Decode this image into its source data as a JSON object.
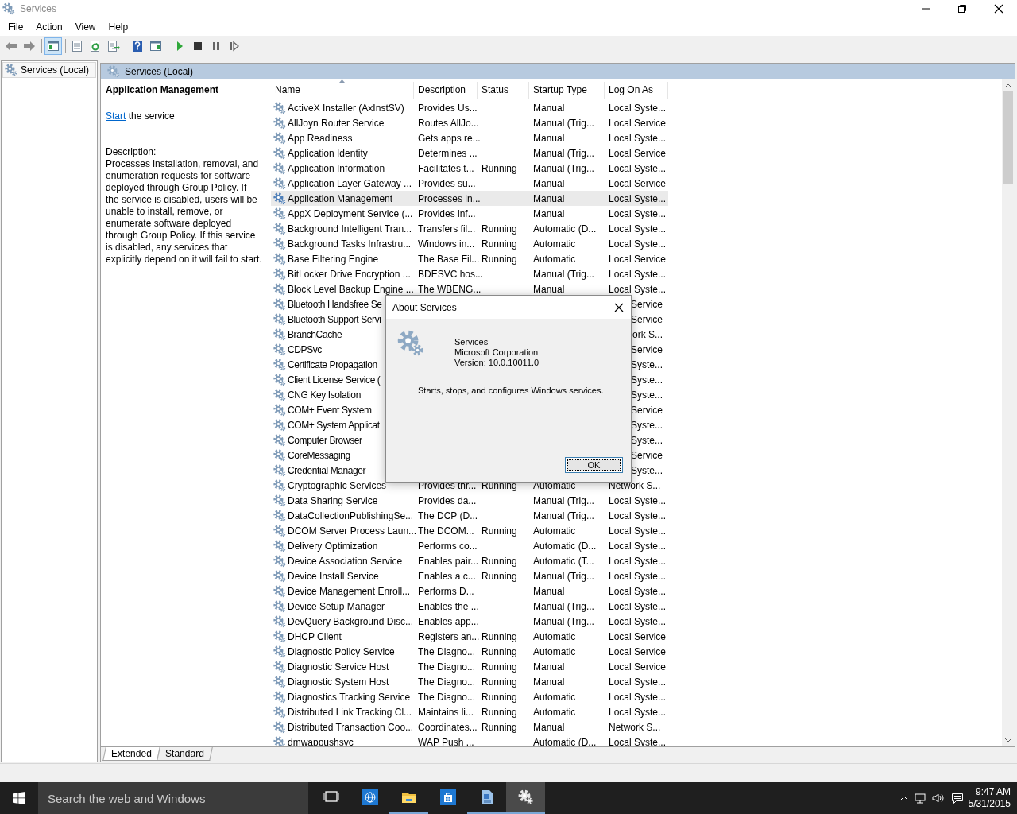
{
  "window": {
    "title": "Services"
  },
  "menu": [
    "File",
    "Action",
    "View",
    "Help"
  ],
  "toolbar": [
    {
      "kind": "back",
      "pressed": false
    },
    {
      "kind": "forward",
      "pressed": false
    },
    {
      "kind": "separator"
    },
    {
      "kind": "console-tree",
      "pressed": true
    },
    {
      "kind": "separator"
    },
    {
      "kind": "properties",
      "pressed": false
    },
    {
      "kind": "refresh",
      "pressed": false
    },
    {
      "kind": "export",
      "pressed": false
    },
    {
      "kind": "separator"
    },
    {
      "kind": "help",
      "pressed": false
    },
    {
      "kind": "action-pane",
      "pressed": false
    },
    {
      "kind": "separator"
    },
    {
      "kind": "start",
      "pressed": false
    },
    {
      "kind": "stop",
      "pressed": false
    },
    {
      "kind": "pause",
      "pressed": false
    },
    {
      "kind": "resume",
      "pressed": false
    }
  ],
  "tree": {
    "items": [
      {
        "label": "Services (Local)",
        "selected": true
      }
    ]
  },
  "main": {
    "header": "Services (Local)",
    "details": {
      "title": "Application Management",
      "action_link": "Start",
      "action_text": "the service",
      "description_label": "Description:",
      "description": "Processes installation, removal, and enumeration requests for software deployed through Group Policy. If the service is disabled, users will be unable to install, remove, or enumerate software deployed through Group Policy. If this service is disabled, any services that explicitly depend on it will fail to start."
    },
    "table": {
      "columns": [
        {
          "label": "Name",
          "sorted": true
        },
        {
          "label": "Description",
          "sorted": false
        },
        {
          "label": "Status",
          "sorted": false
        },
        {
          "label": "Startup Type",
          "sorted": false
        },
        {
          "label": "Log On As",
          "sorted": false
        }
      ],
      "rows": [
        {
          "name": "ActiveX Installer (AxInstSV)",
          "description": "Provides Us...",
          "startup": "Manual",
          "log_on": "Local Syste...",
          "selected": false
        },
        {
          "name": "AllJoyn Router Service",
          "description": "Routes AllJo...",
          "startup": "Manual (Trig...",
          "log_on": "Local Service",
          "selected": false
        },
        {
          "name": "App Readiness",
          "description": "Gets apps re...",
          "startup": "Manual",
          "log_on": "Local Syste...",
          "selected": false
        },
        {
          "name": "Application Identity",
          "description": "Determines ...",
          "startup": "Manual (Trig...",
          "log_on": "Local Service",
          "selected": false
        },
        {
          "name": "Application Information",
          "description": "Facilitates t...",
          "status": "Running",
          "startup": "Manual (Trig...",
          "log_on": "Local Syste...",
          "selected": false
        },
        {
          "name": "Application Layer Gateway ...",
          "description": "Provides su...",
          "startup": "Manual",
          "log_on": "Local Service",
          "selected": false
        },
        {
          "name": "Application Management",
          "description": "Processes in...",
          "startup": "Manual",
          "log_on": "Local Syste...",
          "selected": true
        },
        {
          "name": "AppX Deployment Service (...",
          "description": "Provides inf...",
          "startup": "Manual",
          "log_on": "Local Syste...",
          "selected": false
        },
        {
          "name": "Background Intelligent Tran...",
          "description": "Transfers fil...",
          "status": "Running",
          "startup": "Automatic (D...",
          "log_on": "Local Syste...",
          "selected": false
        },
        {
          "name": "Background Tasks Infrastru...",
          "description": "Windows in...",
          "status": "Running",
          "startup": "Automatic",
          "log_on": "Local Syste...",
          "selected": false
        },
        {
          "name": "Base Filtering Engine",
          "description": "The Base Fil...",
          "status": "Running",
          "startup": "Automatic",
          "log_on": "Local Service",
          "selected": false
        },
        {
          "name": "BitLocker Drive Encryption ...",
          "description": "BDESVC hos...",
          "startup": "Manual (Trig...",
          "log_on": "Local Syste...",
          "selected": false
        },
        {
          "name": "Block Level Backup Engine ...",
          "description": "The WBENG...",
          "startup": "Manual",
          "log_on": "Local Syste...",
          "selected": false
        },
        {
          "name": "Bluetooth Handsfree Se",
          "log_on": "Service",
          "covered": true,
          "selected": false
        },
        {
          "name": "Bluetooth Support Servi",
          "log_on": "Service",
          "covered": true,
          "selected": false
        },
        {
          "name": "BranchCache",
          "log_on": "ork S...",
          "covered": true,
          "selected": false
        },
        {
          "name": "CDPSvc",
          "log_on": "Service",
          "covered": true,
          "selected": false
        },
        {
          "name": "Certificate Propagation",
          "log_on": "Syste...",
          "covered": true,
          "selected": false
        },
        {
          "name": "Client License Service (",
          "log_on": "Syste...",
          "covered": true,
          "selected": false
        },
        {
          "name": "CNG Key Isolation",
          "log_on": "Syste...",
          "covered": true,
          "selected": false
        },
        {
          "name": "COM+ Event System",
          "log_on": "Service",
          "covered": true,
          "selected": false
        },
        {
          "name": "COM+ System Applicat",
          "log_on": "Syste...",
          "covered": true,
          "selected": false
        },
        {
          "name": "Computer Browser",
          "log_on": "Syste...",
          "covered": true,
          "selected": false
        },
        {
          "name": "CoreMessaging",
          "log_on": "Service",
          "covered": true,
          "selected": false
        },
        {
          "name": "Credential Manager",
          "log_on": "Syste...",
          "covered": true,
          "selected": false
        },
        {
          "name": "Cryptographic Services",
          "description": "Provides thr...",
          "status": "Running",
          "startup": "Automatic",
          "log_on": "Network S...",
          "selected": false
        },
        {
          "name": "Data Sharing Service",
          "description": "Provides da...",
          "startup": "Manual (Trig...",
          "log_on": "Local Syste...",
          "selected": false
        },
        {
          "name": "DataCollectionPublishingSe...",
          "description": "The DCP (D...",
          "startup": "Manual (Trig...",
          "log_on": "Local Syste...",
          "selected": false
        },
        {
          "name": "DCOM Server Process Laun...",
          "description": "The DCOM...",
          "status": "Running",
          "startup": "Automatic",
          "log_on": "Local Syste...",
          "selected": false
        },
        {
          "name": "Delivery Optimization",
          "description": "Performs co...",
          "startup": "Automatic (D...",
          "log_on": "Local Syste...",
          "selected": false
        },
        {
          "name": "Device Association Service",
          "description": "Enables pair...",
          "status": "Running",
          "startup": "Automatic (T...",
          "log_on": "Local Syste...",
          "selected": false
        },
        {
          "name": "Device Install Service",
          "description": "Enables a c...",
          "status": "Running",
          "startup": "Manual (Trig...",
          "log_on": "Local Syste...",
          "selected": false
        },
        {
          "name": "Device Management Enroll...",
          "description": "Performs D...",
          "startup": "Manual",
          "log_on": "Local Syste...",
          "selected": false
        },
        {
          "name": "Device Setup Manager",
          "description": "Enables the ...",
          "startup": "Manual (Trig...",
          "log_on": "Local Syste...",
          "selected": false
        },
        {
          "name": "DevQuery Background Disc...",
          "description": "Enables app...",
          "startup": "Manual (Trig...",
          "log_on": "Local Syste...",
          "selected": false
        },
        {
          "name": "DHCP Client",
          "description": "Registers an...",
          "status": "Running",
          "startup": "Automatic",
          "log_on": "Local Service",
          "selected": false
        },
        {
          "name": "Diagnostic Policy Service",
          "description": "The Diagno...",
          "status": "Running",
          "startup": "Automatic",
          "log_on": "Local Service",
          "selected": false
        },
        {
          "name": "Diagnostic Service Host",
          "description": "The Diagno...",
          "status": "Running",
          "startup": "Manual",
          "log_on": "Local Service",
          "selected": false
        },
        {
          "name": "Diagnostic System Host",
          "description": "The Diagno...",
          "status": "Running",
          "startup": "Manual",
          "log_on": "Local Syste...",
          "selected": false
        },
        {
          "name": "Diagnostics Tracking Service",
          "description": "The Diagno...",
          "status": "Running",
          "startup": "Automatic",
          "log_on": "Local Syste...",
          "selected": false
        },
        {
          "name": "Distributed Link Tracking Cl...",
          "description": "Maintains li...",
          "status": "Running",
          "startup": "Automatic",
          "log_on": "Local Syste...",
          "selected": false
        },
        {
          "name": "Distributed Transaction Coo...",
          "description": "Coordinates...",
          "status": "Running",
          "startup": "Manual",
          "log_on": "Network S...",
          "selected": false
        },
        {
          "name": "dmwappushsvc",
          "description": "WAP Push ...",
          "startup": "Automatic (D...",
          "log_on": "Local Syste...",
          "selected": false
        }
      ]
    },
    "tabs": [
      {
        "label": "Extended",
        "selected": true
      },
      {
        "label": "Standard",
        "selected": false
      }
    ]
  },
  "dialog": {
    "title": "About Services",
    "product": "Services",
    "company": "Microsoft Corporation",
    "version": "Version: 10.0.10011.0",
    "description": "Starts, stops, and configures Windows services.",
    "button": "OK"
  },
  "taskbar": {
    "search": {
      "placeholder": "Search the web and Windows"
    },
    "apps": [
      {
        "kind": "task-view",
        "running": false,
        "active": false
      },
      {
        "kind": "globe",
        "running": false,
        "active": false
      },
      {
        "kind": "folder",
        "running": true,
        "active": false
      },
      {
        "kind": "store",
        "running": false,
        "active": false
      },
      {
        "kind": "document",
        "running": true,
        "active": false
      },
      {
        "kind": "services",
        "running": true,
        "active": true
      }
    ],
    "time": "9:47 AM",
    "date": "5/31/2015"
  }
}
